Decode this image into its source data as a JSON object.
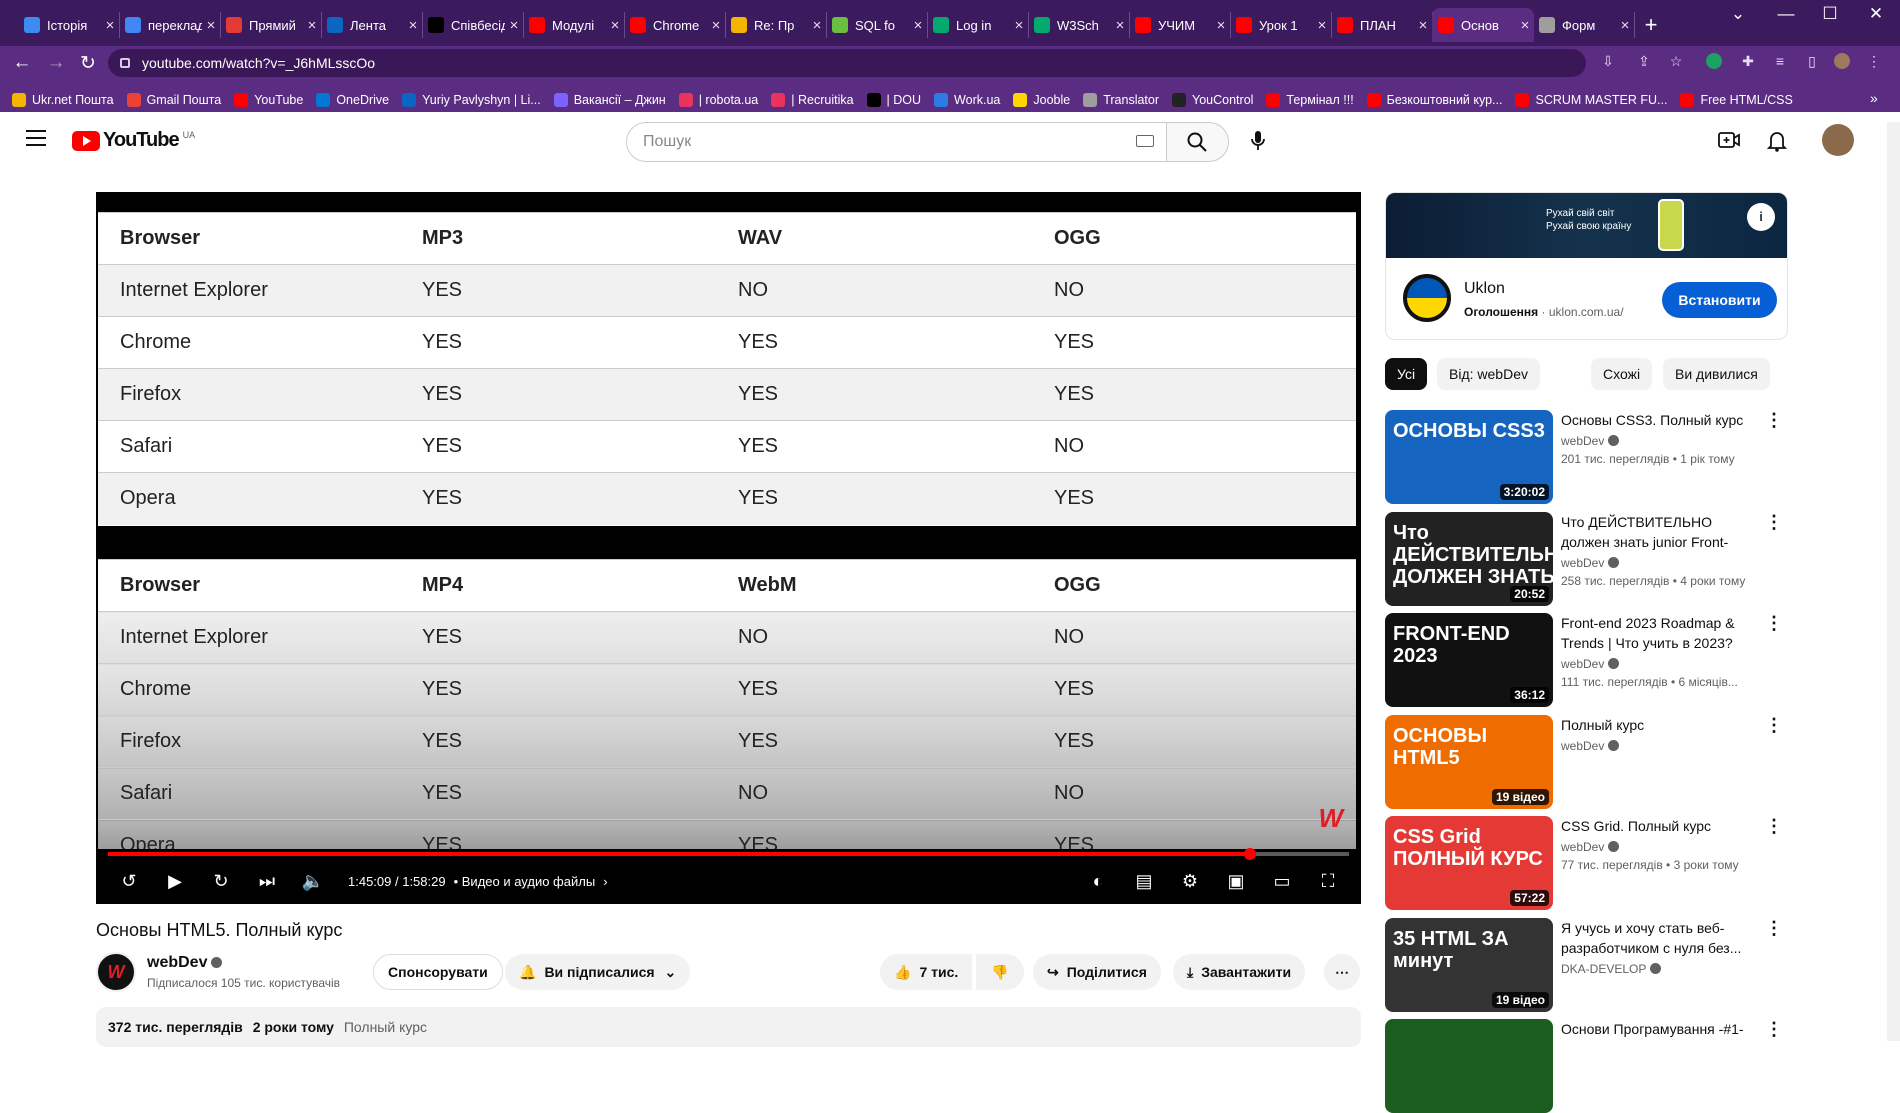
{
  "browser": {
    "tabs": [
      {
        "title": "Історія",
        "color": "#3c8bf3"
      },
      {
        "title": "переклад",
        "color": "#4285f4"
      },
      {
        "title": "Прямий",
        "color": "#e53935"
      },
      {
        "title": "Лента",
        "color": "#0a66c2"
      },
      {
        "title": "Співбесіда",
        "color": "#000000"
      },
      {
        "title": "Модулі",
        "color": "#ff0000"
      },
      {
        "title": "Chrome",
        "color": "#ff0000"
      },
      {
        "title": "Re: Пр",
        "color": "#f4b400"
      },
      {
        "title": "SQL fo",
        "color": "#6abf40"
      },
      {
        "title": "Log in",
        "color": "#04aa6d"
      },
      {
        "title": "W3Sch",
        "color": "#04aa6d"
      },
      {
        "title": "УЧИМ",
        "color": "#ff0000"
      },
      {
        "title": "Урок 1",
        "color": "#ff0000"
      },
      {
        "title": "ПЛАН",
        "color": "#ff0000"
      },
      {
        "title": "Основ",
        "color": "#ff0000"
      },
      {
        "title": "Форм",
        "color": "#9e9e9e"
      }
    ],
    "url": "youtube.com/watch?v=_J6hMLsscOo",
    "bookmarks": [
      {
        "label": "Ukr.net Пошта",
        "color": "#f4b400"
      },
      {
        "label": "Gmail Пошта",
        "color": "#ea4335"
      },
      {
        "label": "YouTube",
        "color": "#ff0000"
      },
      {
        "label": "OneDrive",
        "color": "#0078d4"
      },
      {
        "label": "Yuriy Pavlyshyn | Li...",
        "color": "#0a66c2"
      },
      {
        "label": "Вакансії – Джин",
        "color": "#7b61ff"
      },
      {
        "label": "| robota.ua",
        "color": "#e8335d"
      },
      {
        "label": "| Recruitika",
        "color": "#e8335d"
      },
      {
        "label": "| DOU",
        "color": "#000000"
      },
      {
        "label": "Work.ua",
        "color": "#2d7be5"
      },
      {
        "label": "Jooble",
        "color": "#ffd600"
      },
      {
        "label": "Translator",
        "color": "#9e9e9e"
      },
      {
        "label": "YouControl",
        "color": "#222222"
      },
      {
        "label": "Термінал !!!",
        "color": "#ff0000"
      },
      {
        "label": "Безкоштовний кур...",
        "color": "#ff0000"
      },
      {
        "label": "SCRUM MASTER FU...",
        "color": "#ff0000"
      },
      {
        "label": "Free HTML/CSS",
        "color": "#ff0000"
      }
    ]
  },
  "yt": {
    "logo": "YouTube",
    "country": "UA",
    "search_placeholder": "Пошук"
  },
  "video": {
    "table1": {
      "headers": [
        "Browser",
        "MP3",
        "WAV",
        "OGG"
      ],
      "rows": [
        [
          "Internet Explorer",
          "YES",
          "NO",
          "NO"
        ],
        [
          "Chrome",
          "YES",
          "YES",
          "YES"
        ],
        [
          "Firefox",
          "YES",
          "YES",
          "YES"
        ],
        [
          "Safari",
          "YES",
          "YES",
          "NO"
        ],
        [
          "Opera",
          "YES",
          "YES",
          "YES"
        ]
      ]
    },
    "table2": {
      "headers": [
        "Browser",
        "MP4",
        "WebM",
        "OGG"
      ],
      "rows": [
        [
          "Internet Explorer",
          "YES",
          "NO",
          "NO"
        ],
        [
          "Chrome",
          "YES",
          "YES",
          "YES"
        ],
        [
          "Firefox",
          "YES",
          "YES",
          "YES"
        ],
        [
          "Safari",
          "YES",
          "NO",
          "NO"
        ],
        [
          "Opera",
          "YES",
          "YES",
          "YES"
        ]
      ]
    },
    "watermark": "W",
    "progress": 0.92,
    "time": "1:45:09 / 1:58:29",
    "chapter": "• Видео и аудио файлы",
    "title": "Основы HTML5. Полный курс",
    "channel": "webDev",
    "subs": "Підписалося 105 тис. користувачів",
    "sponsor": "Спонсорувати",
    "subscribed": "Ви підписалися",
    "likes": "7 тис.",
    "share": "Поділитися",
    "download": "Завантажити",
    "views": "372 тис. переглядів",
    "age": "2 роки тому",
    "playlist": "Полный курс"
  },
  "ad": {
    "banner_line1": "Рухай свій світ",
    "banner_line2": "Рухай свою країну",
    "name": "Uklon",
    "label": "Оголошення",
    "domain": "uklon.com.ua/",
    "install": "Встановити"
  },
  "chips": [
    "Усі",
    "Від: webDev",
    "Схожі",
    "Ви дивилися"
  ],
  "related": [
    {
      "thumb": "ОСНОВЫ CSS3",
      "dur": "3:20:02",
      "title": "Основы CSS3. Полный курс",
      "channel": "webDev",
      "meta": "201 тис. переглядів • 1 рік тому",
      "bg": "#1565c0"
    },
    {
      "thumb": "Что ДЕЙСТВИТЕЛЬНО ДОЛЖЕН ЗНАТЬ",
      "dur": "20:52",
      "title": "Что ДЕЙСТВИТЕЛЬНО должен знать junior Front-end...",
      "channel": "webDev",
      "meta": "258 тис. переглядів • 4 роки тому",
      "bg": "#222222"
    },
    {
      "thumb": "FRONT-END 2023",
      "dur": "36:12",
      "title": "Front-end 2023 Roadmap & Trends | Что учить в 2023?",
      "channel": "webDev",
      "meta": "111 тис. переглядів • 6 місяців...",
      "bg": "#111111"
    },
    {
      "thumb": "ОСНОВЫ HTML5",
      "dur": "19 відео",
      "title": "Полный курс",
      "channel": "webDev",
      "meta": "",
      "bg": "#ef6c00"
    },
    {
      "thumb": "CSS Grid ПОЛНЫЙ КУРС",
      "dur": "57:22",
      "title": "CSS Grid. Полный курс",
      "channel": "webDev",
      "meta": "77 тис. переглядів • 3 роки тому",
      "bg": "#e53935"
    },
    {
      "thumb": "35 HTML ЗА минут",
      "dur": "19 відео",
      "title": "Я учусь и хочу стать веб-разработчиком с нуля без...",
      "channel": "DKA-DEVELOP",
      "meta": "",
      "bg": "#333333"
    },
    {
      "thumb": "",
      "dur": "",
      "title": "Основи Програмування -#1-",
      "channel": "",
      "meta": "",
      "bg": "#1b5e20"
    }
  ]
}
